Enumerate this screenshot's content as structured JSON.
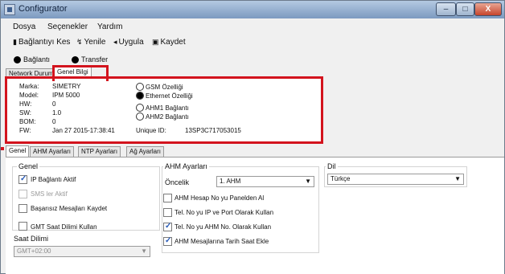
{
  "window": {
    "title": "Configurator",
    "controls": [
      "–",
      "□",
      "X"
    ]
  },
  "menu": {
    "items": [
      "Dosya",
      "Seçenekler",
      "Yardım"
    ]
  },
  "toolbar": {
    "disconnect": "Bağlantıyı Kes",
    "refresh": "Yenile",
    "apply": "Uygula",
    "save": "Kaydet"
  },
  "status": {
    "connection": "Bağlantı",
    "transfer": "Transfer"
  },
  "top_tabs": [
    "Network Durumu",
    "Genel Bilgi"
  ],
  "info": {
    "brand_label": "Marka:",
    "brand": "SIMETRY",
    "model_label": "Model:",
    "model": "IPM 5000",
    "hw_label": "HW:",
    "hw": "0",
    "sw_label": "SW:",
    "sw": "1.0",
    "bom_label": "BOM:",
    "bom": "0",
    "fw_label": "FW:",
    "fw": "Jan 27 2015-17:38:41",
    "gsm": "GSM Özelliği",
    "ethernet": "Ethernet Özelliği",
    "ahm1": "AHM1 Bağlantı",
    "ahm2": "AHM2 Bağlantı",
    "unique_label": "Unique ID:",
    "unique_id": "13SP3C717053015"
  },
  "settings_tabs": [
    "Genel",
    "AHM Ayarları",
    "NTP Ayarları",
    "Ağ Ayarları"
  ],
  "general": {
    "group_title": "Genel",
    "ip_connection": "IP Bağlantı Aktif",
    "sms_active": "SMS ler Aktif",
    "start_message": "Başarısız Mesajları Kaydet",
    "gmt_use": "GMT Saat Dilimi Kullan",
    "timezone_label": "Saat Dilimi",
    "timezone_value": "GMT+02:00"
  },
  "ahm": {
    "group_title": "AHM Ayarları",
    "priority_label": "Öncelik",
    "priority_value": "1. AHM",
    "opt1": "AHM Hesap No yu Panelden Al",
    "opt2": "Tel. No yu IP ve Port Olarak Kullan",
    "opt3": "Tel. No yu AHM No. Olarak Kullan",
    "opt4": "AHM Mesajlarına Tarih Saat Ekle"
  },
  "language": {
    "label": "Dil",
    "value": "Türkçe"
  }
}
